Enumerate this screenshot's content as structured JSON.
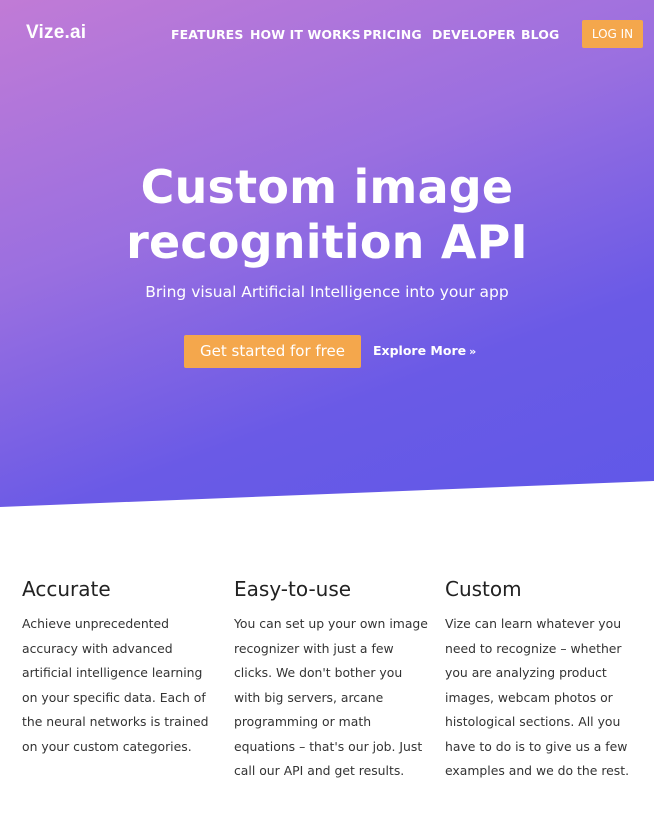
{
  "brand": {
    "logo": "Vize.ai"
  },
  "nav": {
    "items": [
      "FEATURES",
      "HOW IT WORKS",
      "PRICING",
      "DEVELOPER",
      "BLOG"
    ],
    "login": "LOG IN"
  },
  "hero": {
    "title_line1": "Custom image",
    "title_line2": "recognition API",
    "subtitle": "Bring visual Artificial Intelligence into your app",
    "cta": "Get started for free",
    "explore": "Explore More"
  },
  "features": [
    {
      "title": "Accurate",
      "text": "Achieve unprecedented accuracy with advanced artificial intelligence learning on your specific data. Each of the neural networks is trained on your custom categories."
    },
    {
      "title": "Easy-to-use",
      "text": "You can set up your own image recognizer with just a few clicks. We don't bother you with big servers, arcane programming or math equations – that's our job. Just call our API and get results."
    },
    {
      "title": "Custom",
      "text": "Vize can learn whatever you need to recognize – whether you are analyzing product images, webcam photos or histological sections. All you have to do is to give us a few examples and we do the rest."
    }
  ],
  "colors": {
    "accent": "#f4a74c",
    "gradient_top": "#c17bd6",
    "gradient_bottom": "#5f58e8"
  }
}
